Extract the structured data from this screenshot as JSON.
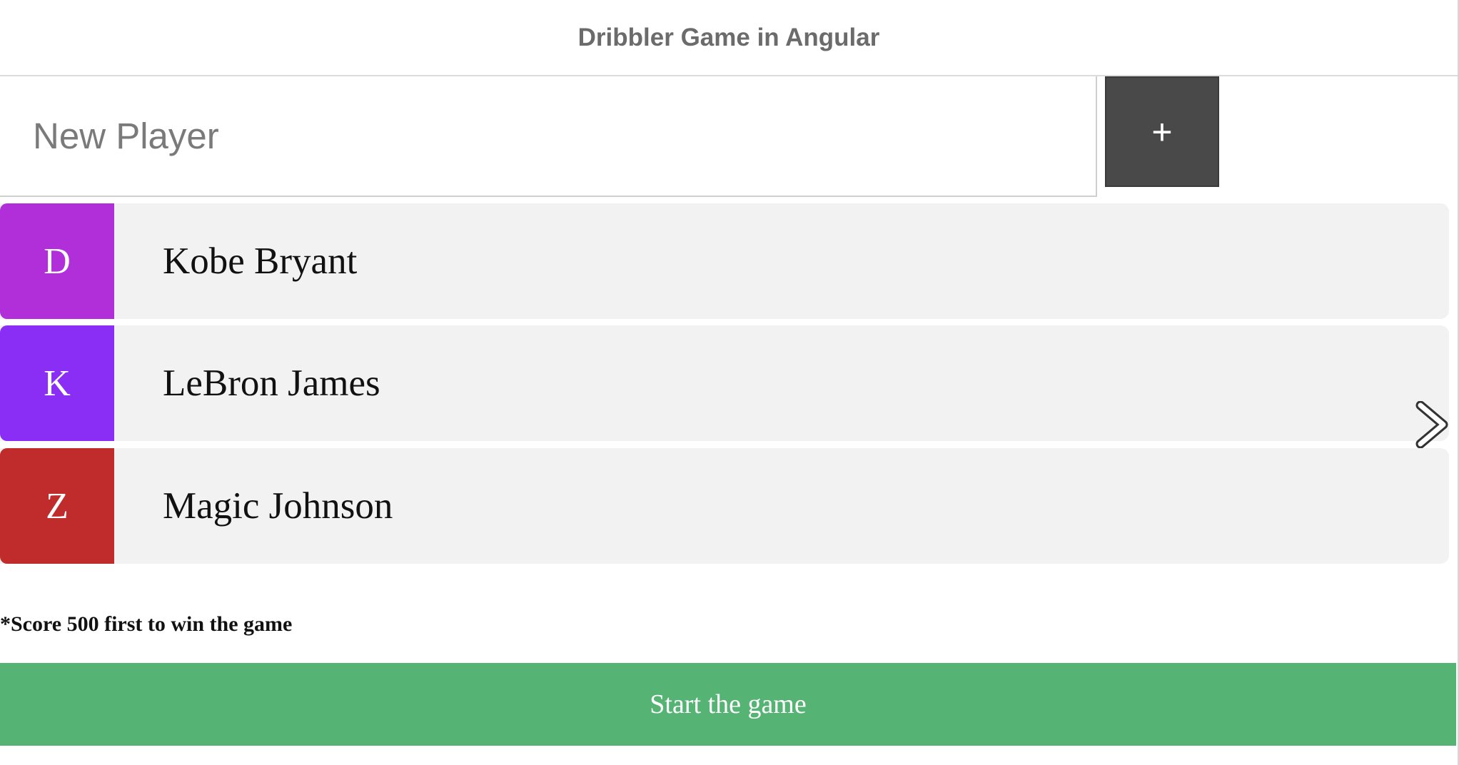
{
  "header": {
    "title": "Dribbler Game in Angular"
  },
  "new_player": {
    "placeholder": "New Player",
    "value": "",
    "add_label": "+"
  },
  "players": [
    {
      "initial": "D",
      "name": "Kobe Bryant",
      "color": "#b02fd8"
    },
    {
      "initial": "K",
      "name": "LeBron James",
      "color": "#8a2ef5"
    },
    {
      "initial": "Z",
      "name": "Magic Johnson",
      "color": "#c02b2b"
    }
  ],
  "icons": {
    "next": "chevron-right-icon"
  },
  "footer": {
    "note": "*Score 500 first to win the game",
    "start_label": "Start the game",
    "start_color": "#55b373"
  }
}
